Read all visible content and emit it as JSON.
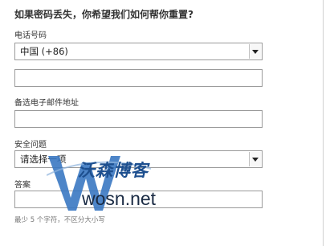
{
  "form": {
    "heading": "如果密码丢失，你希望我们如何帮你重置?",
    "phone": {
      "label": "电话号码",
      "country_value": "中国 (+86)",
      "number_value": ""
    },
    "backup_email": {
      "label": "备选电子邮件地址",
      "value": ""
    },
    "security_question": {
      "label": "安全问题",
      "selected_value": "请选择一项"
    },
    "answer": {
      "label": "答案",
      "value": "",
      "hint": "最少 5 个字符，不区分大小写"
    }
  },
  "watermark": {
    "chinese": "沃森博客",
    "url": "wosn.net",
    "logo_letter_color": "#3a78c2"
  },
  "icons": {
    "dropdown_arrow": "chevron-down-icon"
  }
}
